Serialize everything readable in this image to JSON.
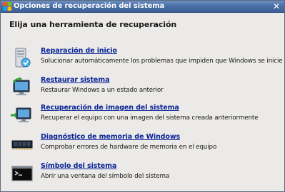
{
  "window": {
    "title": "Opciones de recuperación del sistema",
    "close_glyph": "✕"
  },
  "heading": "Elija una herramienta de recuperación",
  "tools": [
    {
      "icon": "startup-repair-icon",
      "title": "Reparación de inicio",
      "description": "Solucionar automáticamente los problemas que impiden que Windows se inicie"
    },
    {
      "icon": "system-restore-icon",
      "title": "Restaurar sistema",
      "description": "Restaurar Windows a un estado anterior"
    },
    {
      "icon": "system-image-recovery-icon",
      "title": "Recuperación de imagen del sistema",
      "description": "Recuperar el equipo con una imagen del sistema creada anteriormente"
    },
    {
      "icon": "memory-diagnostic-icon",
      "title": "Diagnóstico de memoria de Windows",
      "description": "Comprobar errores de hardware de memoria en el equipo"
    },
    {
      "icon": "command-prompt-icon",
      "title": "Símbolo del sistema",
      "description": "Abrir una ventana del símbolo del sistema"
    }
  ],
  "colors": {
    "link": "#0a2496",
    "titlebar": "#4a6fa8",
    "background": "#ebeae8"
  }
}
